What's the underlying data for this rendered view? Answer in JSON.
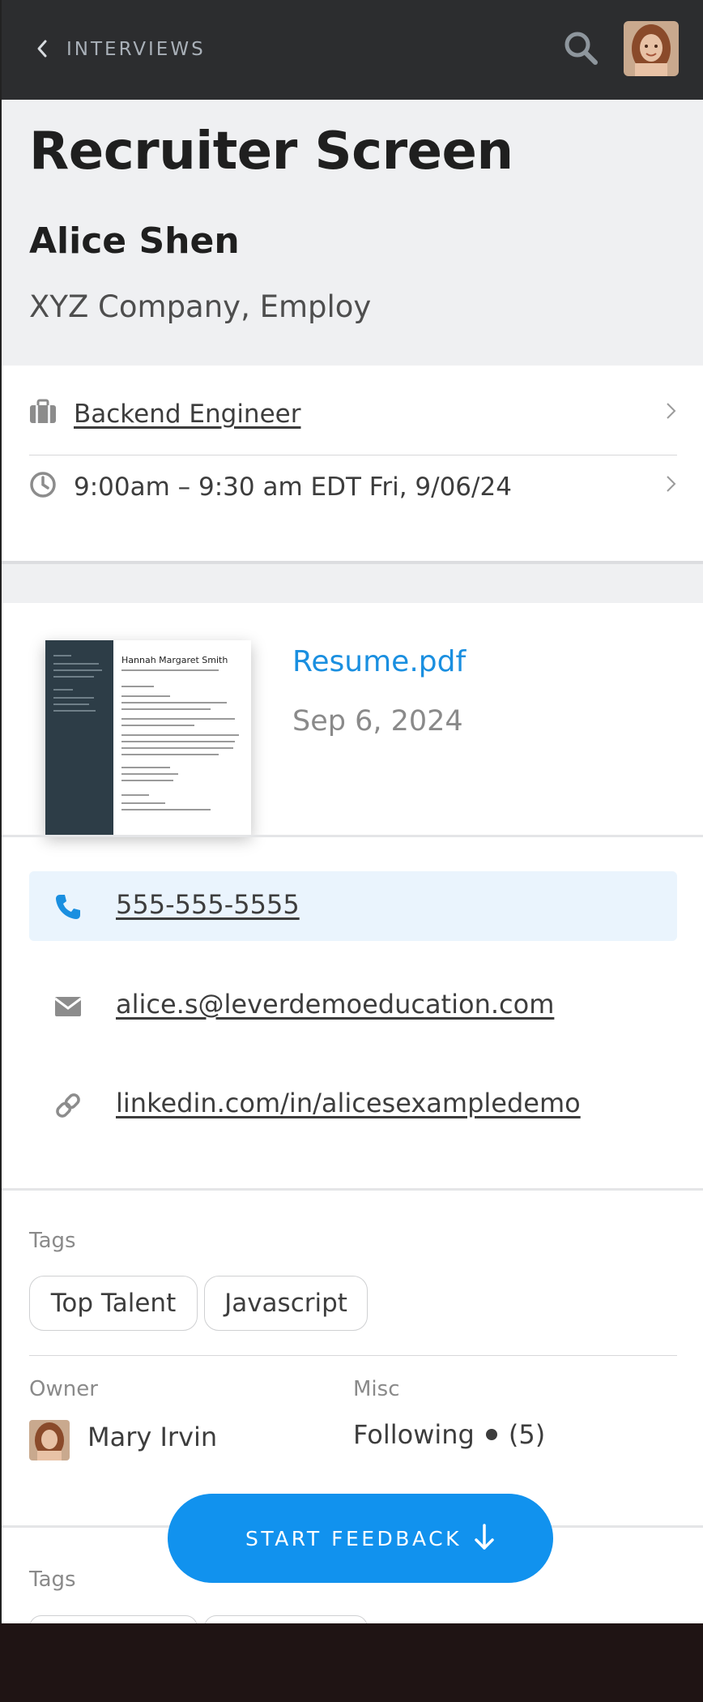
{
  "header": {
    "back_label": "INTERVIEWS"
  },
  "hero": {
    "title": "Recruiter Screen",
    "candidate_name": "Alice Shen",
    "company": "XYZ Company, Employ"
  },
  "details": {
    "position": "Backend Engineer",
    "time": "9:00am – 9:30 am EDT Fri, 9/06/24"
  },
  "resume": {
    "file_name": "Resume.pdf",
    "date": "Sep 6, 2024",
    "thumbnail_name": "Hannah Margaret Smith"
  },
  "contact": {
    "phone": "555-555-5555",
    "email": "alice.s@leverdemoeducation.com",
    "linkedin": "linkedin.com/in/alicesexampledemo"
  },
  "tags": {
    "label": "Tags",
    "items": [
      "Top Talent",
      "Javascript"
    ]
  },
  "owner": {
    "label": "Owner",
    "name": "Mary Irvin"
  },
  "misc": {
    "label": "Misc",
    "following": "Following",
    "count": "(5)"
  },
  "feedback_button": {
    "label": "START FEEDBACK"
  },
  "tags_repeat": {
    "label": "Tags"
  },
  "colors": {
    "accent": "#1192ee",
    "header_bg": "#2c2d2f",
    "hero_bg": "#eff0f2"
  }
}
